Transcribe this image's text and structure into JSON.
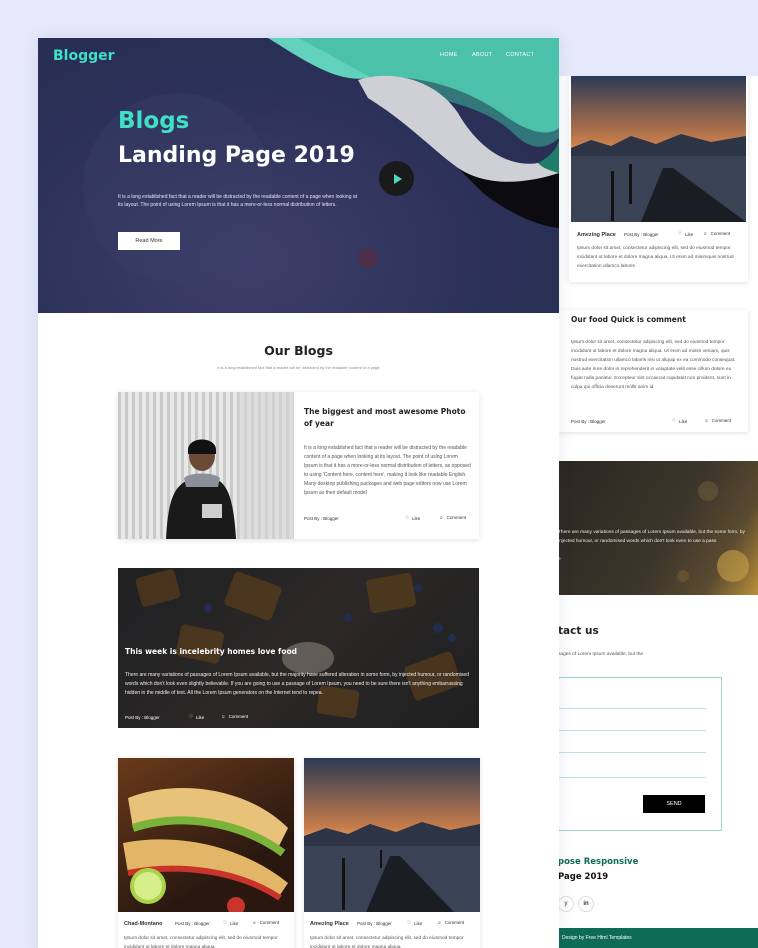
{
  "front": {
    "logo": "Blogger",
    "nav": [
      "HOME",
      "ABOUT",
      "CONTACT"
    ],
    "hero": {
      "title_accent": "Blogs",
      "title": "Landing Page 2019",
      "description": "It is a long established fact that a reader will be distracted by the readable content of a page when looking at its layout. The point of using Lorem Ipsum is that it has a more-or-less normal distribution of letters.",
      "button": "Read More"
    },
    "section": {
      "title": "Our Blogs",
      "subtitle": "It is a long established fact that a reader will be distracted by the readable content of a page"
    },
    "featured": {
      "title": "The biggest and most awesome Photo of year",
      "text": "It is a long established fact that a reader will be distracted by the readable content of a page when looking at its layout. The point of using Lorem Ipsum is that it has a more-or-less normal distribution of letters, as opposed to using 'Content here, content here', making it look like readable English. Many desktop publishing packages and web page editors now use Lorem Ipsum as their default model",
      "post_by": "Post By : Blogger",
      "like": "Like",
      "comment": "Comment"
    },
    "food": {
      "title": "This week is incelebrity homes love food",
      "text": "There are many variations of passages of Lorem Ipsum available, but the majority have suffered alteration in some form, by injected humour, or randomised words which don't look even slightly believable. If you are going to use a passage of Lorem Ipsum, you need to be sure there isn't anything embarrassing hidden in the middle of text. All the Lorem Ipsum generators on the Internet tend to repea.",
      "post_by": "Post By : Blogger",
      "like": "Like",
      "comment": "Comment"
    },
    "small_cards": [
      {
        "name": "Chad-Montano",
        "post_by": "Post By : Blogger",
        "like": "Like",
        "comment": "Comment",
        "text": "Ipsum dolor sit amet, consectetur adipiscing elit, sed do eiusmod tempor incididunt ut labore et dolore magna aliqua."
      },
      {
        "name": "Amezing Place",
        "post_by": "Post By : Blogger",
        "like": "Like",
        "comment": "Comment",
        "text": "Ipsum dolor sit amet, consectetur adipiscing elit, sed do eiusmod tempor incididunt ut labore et dolore magna aliqua."
      }
    ]
  },
  "back": {
    "place_card": {
      "name": "Amezing Place",
      "post_by": "Post By : Blogger",
      "like": "Like",
      "comment": "Comment",
      "text": "Ipsum dolor sit amet, consectetur adipiscing elit, sed do eiusmod tempor incididunt ut labore et dolore magna aliqua. Ut enim ad minimquis nostrud exercitation ullamco laboris"
    },
    "comment_card": {
      "title": "Our food Quick is comment",
      "text": "Ipsum dolor sit amet, consectetur adipiscing elit, sed do eiusmod tempor incididunt ut labore et dolore magna aliqua. Ut enim ad minim veniam, quis nostrud exercitation ullamco laboris nisi ut aliquip ex ea commodo consequat. Duis aute irure dolor in reprehenderit in voluptate velit esse cillum dolore eu fugiat nulla pariatur. Excepteur sint occaecat cupidatat non proident, sunt in culpa qui officia deserunt mollit anim id",
      "post_by": "Post By : Blogger",
      "like": "Like",
      "comment": "Comment"
    },
    "dark_strip_text": "There are many variations of passages of Lorem Ipsum available, but the some form, by injected humour, or randomised words which don't look even to use a pass",
    "dark_strip_more": "e",
    "contact_title": "tact us",
    "contact_sub": "sages of Lorem Ipsum available, but the",
    "send": "SEND",
    "purpose_title": "pose Responsive",
    "purpose_sub": "Page 2019",
    "social": [
      "y",
      "in"
    ],
    "footer": "Design by Free Html Templates"
  }
}
